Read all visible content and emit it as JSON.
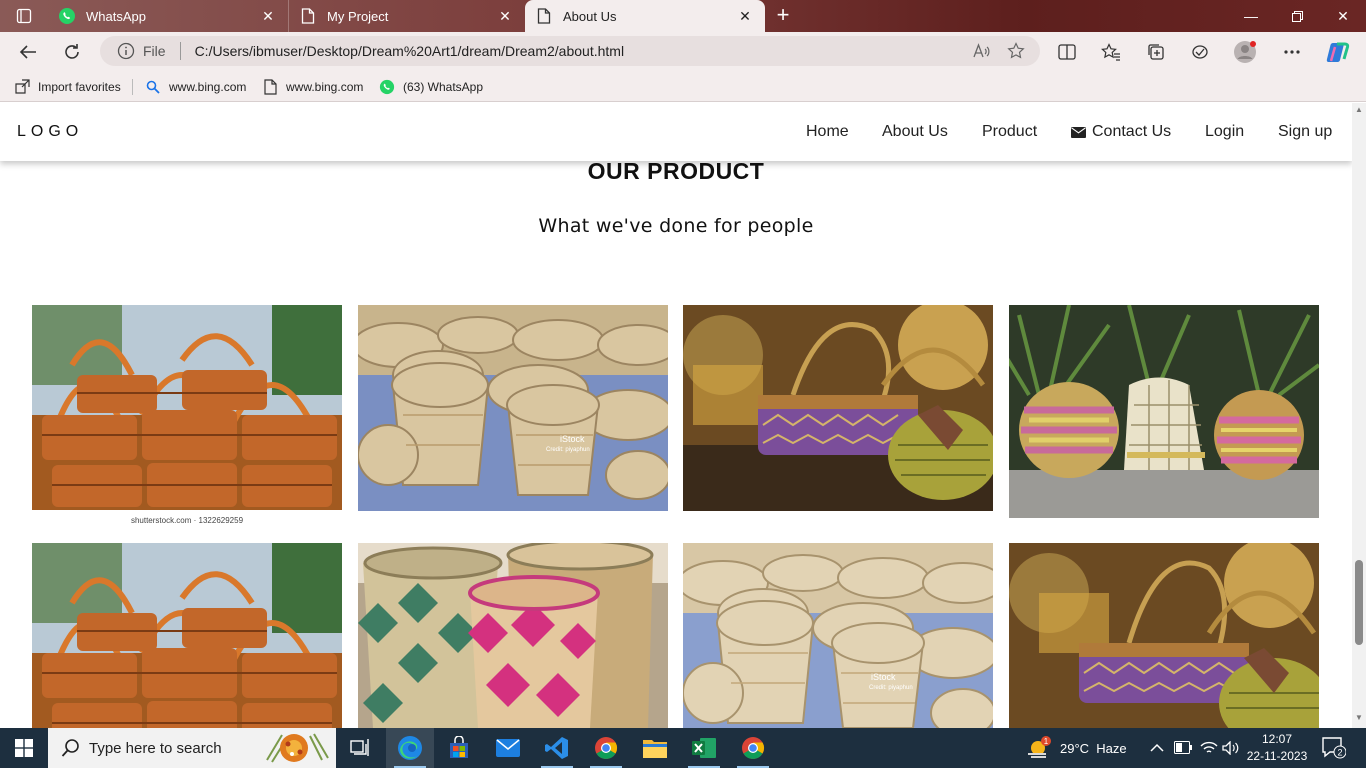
{
  "browser": {
    "tabs": [
      {
        "title": "WhatsApp",
        "icon": "whatsapp-icon"
      },
      {
        "title": "My Project",
        "icon": "page-icon"
      },
      {
        "title": "About Us",
        "icon": "page-icon",
        "active": true
      }
    ],
    "address": {
      "scheme_label": "File",
      "url": "C:/Users/ibmuser/Desktop/Dream%20Art1/dream/Dream2/about.html"
    },
    "favorites": [
      {
        "label": "Import favorites",
        "icon": "import-icon"
      },
      {
        "label": "www.bing.com",
        "icon": "search-icon"
      },
      {
        "label": "www.bing.com",
        "icon": "page-icon"
      },
      {
        "label": "(63) WhatsApp",
        "icon": "whatsapp-icon"
      }
    ],
    "accent": "#7a3a38"
  },
  "site": {
    "logo": "LOGO",
    "nav": [
      "Home",
      "About Us",
      "Product",
      "Contact Us",
      "Login",
      "Sign up"
    ],
    "section_title": "OUR PRODUCT",
    "section_subtitle": "What we've done for people",
    "watermarks": {
      "shutterstock": "shutterstock.com · 1322629259",
      "istock": "iStock",
      "istock_credit": "Credit: piyaphun"
    },
    "products": [
      {
        "subject": "stacked orange woven baskets with handles"
      },
      {
        "subject": "pile of natural bamboo bowls"
      },
      {
        "subject": "woven bag with round handle"
      },
      {
        "subject": "pink yellow woven pots with plants"
      },
      {
        "subject": "stacked orange woven baskets with handles"
      },
      {
        "subject": "pink and green woven bins"
      },
      {
        "subject": "pile of natural bamboo bowls"
      },
      {
        "subject": "woven bag with round handle"
      }
    ]
  },
  "taskbar": {
    "search_placeholder": "Type here to search",
    "weather": "29°C  Haze",
    "time": "12:07",
    "date": "22-11-2023",
    "notification_count": "2",
    "weather_badge": "1"
  }
}
